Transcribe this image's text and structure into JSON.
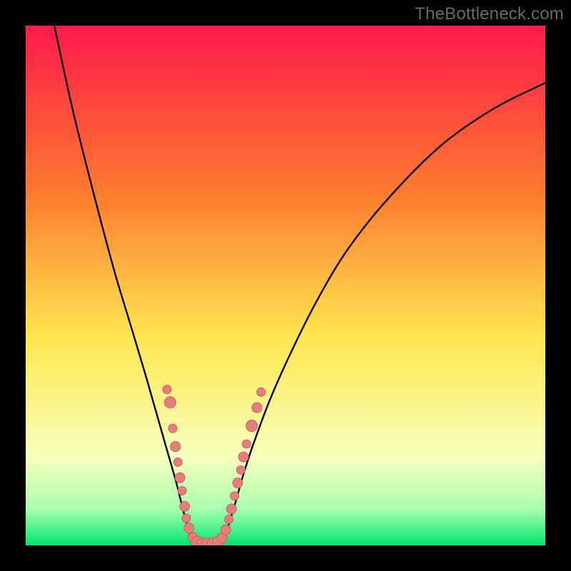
{
  "watermark": "TheBottleneck.com",
  "colors": {
    "frame": "#000000",
    "curve": "#000000",
    "dot_fill": "#e97c7c",
    "dot_stroke": "#c96262",
    "grad_top": "#ff1a4b",
    "grad_mid1": "#ff7a2f",
    "grad_mid2": "#ffe750",
    "grad_low": "#f6ffba",
    "grad_green_top": "#a9ffb0",
    "grad_green_bot": "#00e66a"
  },
  "chart_data": {
    "type": "line",
    "title": "",
    "xlabel": "",
    "ylabel": "",
    "xlim": [
      0,
      100
    ],
    "ylim": [
      0,
      100
    ],
    "curve_points": [
      {
        "x": 5.5,
        "y": 100
      },
      {
        "x": 9,
        "y": 84
      },
      {
        "x": 13,
        "y": 68
      },
      {
        "x": 17,
        "y": 53
      },
      {
        "x": 20,
        "y": 43
      },
      {
        "x": 23,
        "y": 33
      },
      {
        "x": 25,
        "y": 26
      },
      {
        "x": 27,
        "y": 19
      },
      {
        "x": 29,
        "y": 12
      },
      {
        "x": 30.5,
        "y": 6
      },
      {
        "x": 32,
        "y": 1.2
      },
      {
        "x": 34,
        "y": 0.3
      },
      {
        "x": 36,
        "y": 0.3
      },
      {
        "x": 38,
        "y": 1.2
      },
      {
        "x": 40,
        "y": 7
      },
      {
        "x": 42,
        "y": 14
      },
      {
        "x": 44,
        "y": 20
      },
      {
        "x": 47,
        "y": 28
      },
      {
        "x": 51,
        "y": 37
      },
      {
        "x": 56,
        "y": 47
      },
      {
        "x": 62,
        "y": 57
      },
      {
        "x": 70,
        "y": 67
      },
      {
        "x": 80,
        "y": 77
      },
      {
        "x": 90,
        "y": 84
      },
      {
        "x": 100,
        "y": 89
      }
    ],
    "dots": [
      {
        "x": 27.2,
        "y": 30,
        "r": 6
      },
      {
        "x": 27.8,
        "y": 27.5,
        "r": 8
      },
      {
        "x": 28.3,
        "y": 22.5,
        "r": 6
      },
      {
        "x": 28.8,
        "y": 19,
        "r": 7
      },
      {
        "x": 29.3,
        "y": 16,
        "r": 6
      },
      {
        "x": 29.7,
        "y": 13,
        "r": 7
      },
      {
        "x": 30.1,
        "y": 10.5,
        "r": 6
      },
      {
        "x": 30.6,
        "y": 7.5,
        "r": 7
      },
      {
        "x": 30.9,
        "y": 5.2,
        "r": 6
      },
      {
        "x": 31.4,
        "y": 3.3,
        "r": 7
      },
      {
        "x": 32.2,
        "y": 1.5,
        "r": 7
      },
      {
        "x": 33.0,
        "y": 0.6,
        "r": 8
      },
      {
        "x": 34.0,
        "y": 0.3,
        "r": 8
      },
      {
        "x": 35.0,
        "y": 0.3,
        "r": 8
      },
      {
        "x": 36.0,
        "y": 0.3,
        "r": 8
      },
      {
        "x": 37.0,
        "y": 0.6,
        "r": 8
      },
      {
        "x": 37.8,
        "y": 1.4,
        "r": 7
      },
      {
        "x": 38.5,
        "y": 3.0,
        "r": 7
      },
      {
        "x": 39.1,
        "y": 5.0,
        "r": 6
      },
      {
        "x": 39.6,
        "y": 7.0,
        "r": 7
      },
      {
        "x": 40.2,
        "y": 9.5,
        "r": 6
      },
      {
        "x": 40.8,
        "y": 12.0,
        "r": 7
      },
      {
        "x": 41.4,
        "y": 14.5,
        "r": 6
      },
      {
        "x": 41.9,
        "y": 17.0,
        "r": 7
      },
      {
        "x": 42.5,
        "y": 19.5,
        "r": 6
      },
      {
        "x": 43.5,
        "y": 23.0,
        "r": 8
      },
      {
        "x": 44.5,
        "y": 26.5,
        "r": 7
      },
      {
        "x": 45.3,
        "y": 29.5,
        "r": 6
      }
    ]
  }
}
